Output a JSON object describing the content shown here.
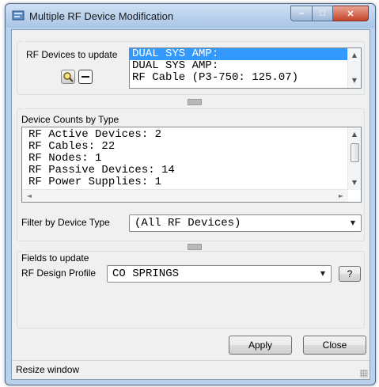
{
  "window": {
    "title": "Multiple RF Device Modification",
    "controls": {
      "minimize": "–",
      "maximize": "□",
      "close": "✕"
    }
  },
  "rf_devices": {
    "label": "RF Devices to update",
    "items": [
      "DUAL SYS AMP:",
      "DUAL SYS AMP:",
      "RF Cable (P3-750: 125.07)"
    ],
    "selected_index": 0,
    "zoom_icon": "zoom-magnifier-icon",
    "remove_icon": "remove-minus-icon"
  },
  "device_counts": {
    "label": "Device Counts by Type",
    "items": [
      "RF Active Devices: 2",
      "RF Cables: 22",
      "RF Nodes: 1",
      "RF Passive Devices: 14",
      "RF Power Supplies: 1"
    ]
  },
  "filter": {
    "label": "Filter by Device Type",
    "value": "(All RF Devices)"
  },
  "fields": {
    "label": "Fields to update",
    "profile_label": "RF Design Profile",
    "profile_value": "CO SPRINGS",
    "help_label": "?"
  },
  "buttons": {
    "apply": "Apply",
    "close": "Close"
  },
  "status": {
    "text": "Resize window"
  },
  "colors": {
    "selection": "#3399ff",
    "titlebar": "#b9d1ea",
    "close_button": "#c6442a"
  }
}
